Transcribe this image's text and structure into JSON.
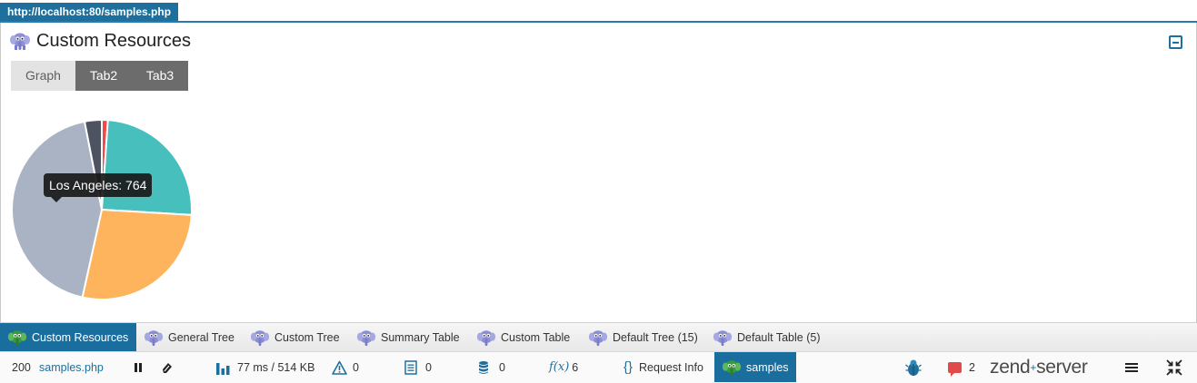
{
  "address_bar": {
    "url": "http://localhost:80/samples.php"
  },
  "panel": {
    "title": "Custom Resources",
    "icon": "elephant-icon",
    "tabs": [
      "Graph",
      "Tab2",
      "Tab3"
    ],
    "active_tab": "Graph"
  },
  "chart_data": {
    "type": "pie",
    "title": "",
    "tooltip": "Los Angeles: 764",
    "slices": [
      {
        "label": "",
        "value": 19,
        "color": "#f7464a"
      },
      {
        "label": "",
        "value": 437,
        "color": "#46bfbd"
      },
      {
        "label": "",
        "value": 484,
        "color": "#fdb45c"
      },
      {
        "label": "Los Angeles",
        "value": 764,
        "color": "#aab3c4"
      },
      {
        "label": "",
        "value": 54,
        "color": "#4d5360"
      }
    ]
  },
  "bottom_tabs": [
    {
      "label": "Custom Resources",
      "icon": "green-elephant-icon",
      "active": true
    },
    {
      "label": "General Tree",
      "icon": "elephant-icon",
      "active": false
    },
    {
      "label": "Custom Tree",
      "icon": "elephant-icon",
      "active": false
    },
    {
      "label": "Summary Table",
      "icon": "elephant-icon",
      "active": false
    },
    {
      "label": "Custom Table",
      "icon": "elephant-icon",
      "active": false
    },
    {
      "label": "Default Tree (15)",
      "icon": "elephant-icon",
      "active": false
    },
    {
      "label": "Default Table (5)",
      "icon": "elephant-icon",
      "active": false
    }
  ],
  "toolbar": {
    "status_code": "200",
    "script_name": "samples.php",
    "timing": "77 ms / 514 KB",
    "warnings": "0",
    "logs": "0",
    "queries": "0",
    "functions": "6",
    "request_info_label": "Request Info",
    "samples_label": "samples",
    "messages_count": "2",
    "brand_text": "zend",
    "brand_mark": "+",
    "brand_suffix": "server",
    "colors": {
      "accent": "#1a6e9e",
      "alert": "#e04a4a"
    }
  }
}
